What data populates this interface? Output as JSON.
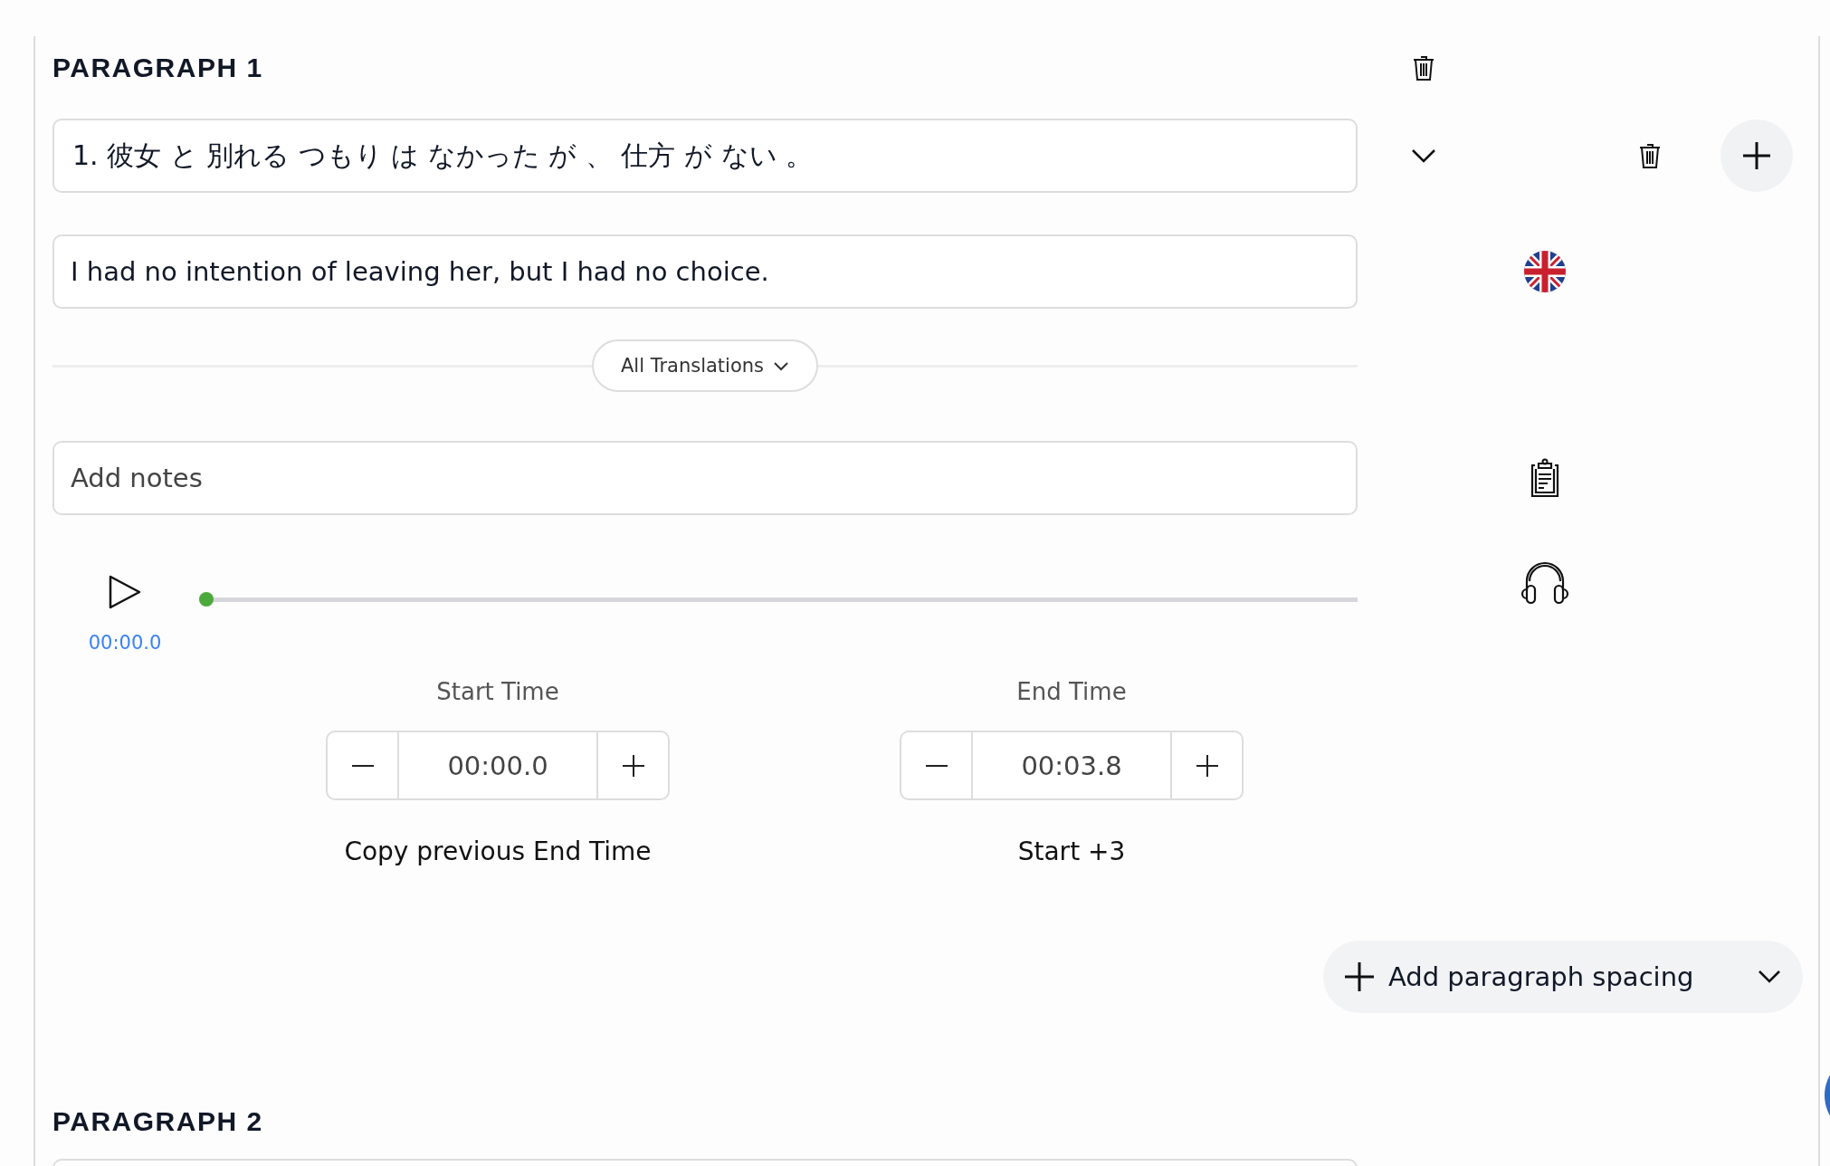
{
  "paragraphs": [
    {
      "heading": "PARAGRAPH 1",
      "sentence": "1. 彼女 と 別れる つもり は なかった が 、 仕方 が ない 。",
      "translation": "I had no intention of leaving her, but I had no choice.",
      "translations_button": "All Translations",
      "notes": {
        "placeholder": "Add notes"
      },
      "audio": {
        "time": "00:00.0",
        "level": 0
      },
      "start_time": {
        "label": "Start Time",
        "value": "00:00.0",
        "shortcut": "Copy previous End Time"
      },
      "end_time": {
        "label": "End Time",
        "value": "00:03.8",
        "shortcut": "Start +3"
      },
      "spacing_button": "Add paragraph spacing"
    },
    {
      "heading": "PARAGRAPH 2"
    }
  ]
}
